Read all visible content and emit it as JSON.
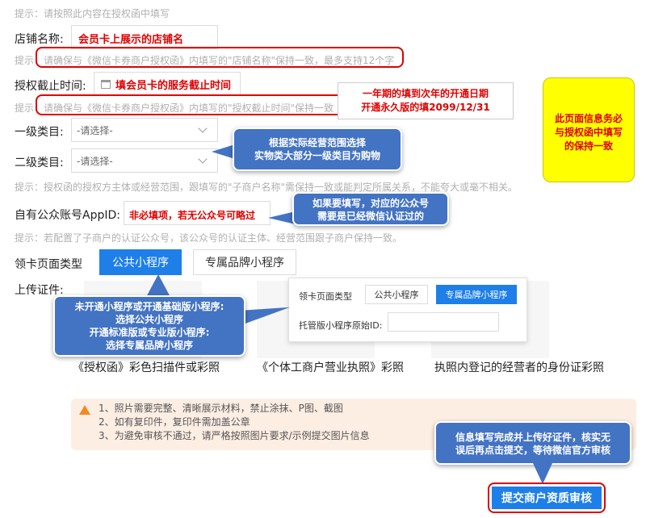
{
  "top_hint": "提示：请按照此内容在授权函中填写",
  "store_name": {
    "label": "店铺名称:",
    "value": "会员卡上展示的店铺名",
    "hint": "请确保与《微信卡券商户授权函》内填写的\"店铺名称\"保持一致，最多支持12个字",
    "hint_prefix": "提示："
  },
  "deadline": {
    "label": "授权截止时间:",
    "value": "填会员卡的服务截止时间",
    "hint": "请确保与《微信卡券商户授权函》内填写的\"授权截止时间\"保持一致",
    "hint_prefix": "提示："
  },
  "deadline_note": {
    "line1": "一年期的填到次年的开通日期",
    "line2": "开通永久版的填2099/12/31"
  },
  "category1": {
    "label": "一级类目:",
    "placeholder": "-请选择-"
  },
  "category2": {
    "label": "二级类目:",
    "placeholder": "-请选择-"
  },
  "category_hint": "提示：授权函的授权方主体或经营范围，跟填写的\"子商户名称\"需保持一致或能判定所属关系，不能夸大或毫不相关。",
  "category_callout": {
    "line1": "根据实际经营范围选择",
    "line2": "实物类大部分一级类目为购物"
  },
  "appid": {
    "label": "自有公众账号AppID:",
    "value": "非必填项，若无公众号可略过",
    "hint": "提示：若配置了子商户的认证公众号，该公众号的认证主体、经营范围跟子商户保持一致。"
  },
  "appid_callout": {
    "line1": "如果要填写，对应的公众号",
    "line2": "需要是已经微信认证过的"
  },
  "card_page": {
    "label": "领卡页面类型",
    "tab_public": "公共小程序",
    "tab_brand": "专属品牌小程序"
  },
  "upload_label": "上传证件:",
  "popup": {
    "label": "领卡页面类型",
    "tab_public": "公共小程序",
    "tab_brand": "专属品牌小程序",
    "original_id_label": "托管版小程序原始ID:"
  },
  "miniprogram_callout": {
    "line1": "未开通小程序或开通基础版小程序:",
    "line2": "选择公共小程序",
    "line3": "开通标准版或专业版小程序:",
    "line4": "选择专属品牌小程序"
  },
  "docs": {
    "auth_letter": "《授权函》彩色扫描件或彩照",
    "business_license": "《个体工商户营业执照》彩照",
    "id_card": "执照内登记的经营者的身份证彩照"
  },
  "warning": {
    "line1": "1、照片需要完整、清晰展示材料，禁止涂抹、P图、截图",
    "line2": "2、如有复印件，复印件需加盖公章",
    "line3": "3、为避免审核不通过，请严格按照图片要求/示例提交图片信息"
  },
  "submit_callout": {
    "line1": "信息填写完成并上传好证件，核实无",
    "line2": "误后再点击提交，等待微信官方审核"
  },
  "yellow_note": {
    "line1": "此页面信息务必",
    "line2": "与授权函中填写",
    "line3": "的保持一致"
  },
  "submit_button": "提交商户资质审核",
  "colors": {
    "accent_blue": "#1e7fe8",
    "callout_blue": "#4373c3",
    "annotation_red": "#e00000",
    "yellow_note": "#ffff00",
    "warning_bg": "#fdeee4"
  }
}
